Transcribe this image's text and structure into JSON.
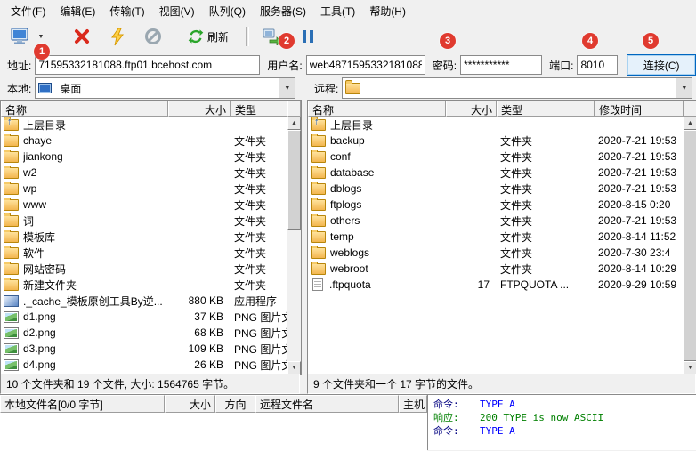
{
  "menu": {
    "items": [
      "文件(F)",
      "编辑(E)",
      "传输(T)",
      "视图(V)",
      "队列(Q)",
      "服务器(S)",
      "工具(T)",
      "帮助(H)"
    ]
  },
  "toolbar": {
    "refresh_label": "刷新",
    "icons": [
      "computer-connect-icon",
      "chevron-down-icon",
      "disconnect-icon",
      "quick-connect-icon",
      "abort-icon",
      "refresh-icon",
      "transfer-icon",
      "pause-icon"
    ]
  },
  "connection": {
    "address_label": "地址:",
    "address_value": "71595332181088.ftp01.bcehost.com",
    "username_label": "用户名:",
    "username_value": "web4871595332181088",
    "password_label": "密码:",
    "password_value": "***********",
    "port_label": "端口:",
    "port_value": "8010",
    "connect_label": "连接(C)"
  },
  "local_pane": {
    "label": "本地:",
    "path_value": "桌面",
    "columns": {
      "name": "名称",
      "size": "大小",
      "type": "类型"
    },
    "rows": [
      {
        "icon": "folder-up",
        "name": "上层目录",
        "size": "",
        "type": ""
      },
      {
        "icon": "folder",
        "name": "chaye",
        "size": "",
        "type": "文件夹"
      },
      {
        "icon": "folder",
        "name": "jiankong",
        "size": "",
        "type": "文件夹"
      },
      {
        "icon": "folder",
        "name": "w2",
        "size": "",
        "type": "文件夹"
      },
      {
        "icon": "folder",
        "name": "wp",
        "size": "",
        "type": "文件夹"
      },
      {
        "icon": "folder",
        "name": "www",
        "size": "",
        "type": "文件夹"
      },
      {
        "icon": "folder",
        "name": "词",
        "size": "",
        "type": "文件夹"
      },
      {
        "icon": "folder",
        "name": "模板库",
        "size": "",
        "type": "文件夹"
      },
      {
        "icon": "folder",
        "name": "软件",
        "size": "",
        "type": "文件夹"
      },
      {
        "icon": "folder",
        "name": "网站密码",
        "size": "",
        "type": "文件夹"
      },
      {
        "icon": "folder",
        "name": "新建文件夹",
        "size": "",
        "type": "文件夹"
      },
      {
        "icon": "app",
        "name": "._cache_模板原创工具By逆...",
        "size": "880 KB",
        "type": "应用程序"
      },
      {
        "icon": "png",
        "name": "d1.png",
        "size": "37 KB",
        "type": "PNG 图片文件"
      },
      {
        "icon": "png",
        "name": "d2.png",
        "size": "68 KB",
        "type": "PNG 图片文件"
      },
      {
        "icon": "png",
        "name": "d3.png",
        "size": "109 KB",
        "type": "PNG 图片文件"
      },
      {
        "icon": "png",
        "name": "d4.png",
        "size": "26 KB",
        "type": "PNG 图片文件"
      }
    ],
    "status": "10 个文件夹和 19 个文件, 大小: 1564765 字节。"
  },
  "remote_pane": {
    "label": "远程:",
    "path_value": "",
    "columns": {
      "name": "名称",
      "size": "大小",
      "type": "类型",
      "mtime": "修改时间"
    },
    "rows": [
      {
        "icon": "folder-up",
        "name": "上层目录",
        "size": "",
        "type": "",
        "mtime": ""
      },
      {
        "icon": "folder",
        "name": "backup",
        "size": "",
        "type": "文件夹",
        "mtime": "2020-7-21 19:53"
      },
      {
        "icon": "folder",
        "name": "conf",
        "size": "",
        "type": "文件夹",
        "mtime": "2020-7-21 19:53"
      },
      {
        "icon": "folder",
        "name": "database",
        "size": "",
        "type": "文件夹",
        "mtime": "2020-7-21 19:53"
      },
      {
        "icon": "folder",
        "name": "dblogs",
        "size": "",
        "type": "文件夹",
        "mtime": "2020-7-21 19:53"
      },
      {
        "icon": "folder",
        "name": "ftplogs",
        "size": "",
        "type": "文件夹",
        "mtime": "2020-8-15 0:20"
      },
      {
        "icon": "folder",
        "name": "others",
        "size": "",
        "type": "文件夹",
        "mtime": "2020-7-21 19:53"
      },
      {
        "icon": "folder",
        "name": "temp",
        "size": "",
        "type": "文件夹",
        "mtime": "2020-8-14 11:52"
      },
      {
        "icon": "folder",
        "name": "weblogs",
        "size": "",
        "type": "文件夹",
        "mtime": "2020-7-30 23:4"
      },
      {
        "icon": "folder",
        "name": "webroot",
        "size": "",
        "type": "文件夹",
        "mtime": "2020-8-14 10:29"
      },
      {
        "icon": "file",
        "name": ".ftpquota",
        "size": "17",
        "type": "FTPQUOTA ...",
        "mtime": "2020-9-29 10:59"
      }
    ],
    "status": "9 个文件夹和一个 17 字节的文件。"
  },
  "queue": {
    "columns": [
      "本地文件名[0/0 字节]",
      "大小",
      "方向",
      "远程文件名",
      "主机"
    ]
  },
  "log": {
    "lines": [
      {
        "kind": "command",
        "label": "命令:",
        "text": "TYPE A"
      },
      {
        "kind": "response",
        "label": "响应:",
        "text": "200 TYPE is now ASCII"
      },
      {
        "kind": "command",
        "label": "命令:",
        "text": "TYPE A"
      }
    ]
  },
  "badges": [
    "1",
    "2",
    "3",
    "4",
    "5"
  ],
  "colors": {
    "badge": "#e03a2f",
    "accent": "#0066c0",
    "command_text": "#0000ff",
    "response_text": "#008000"
  }
}
